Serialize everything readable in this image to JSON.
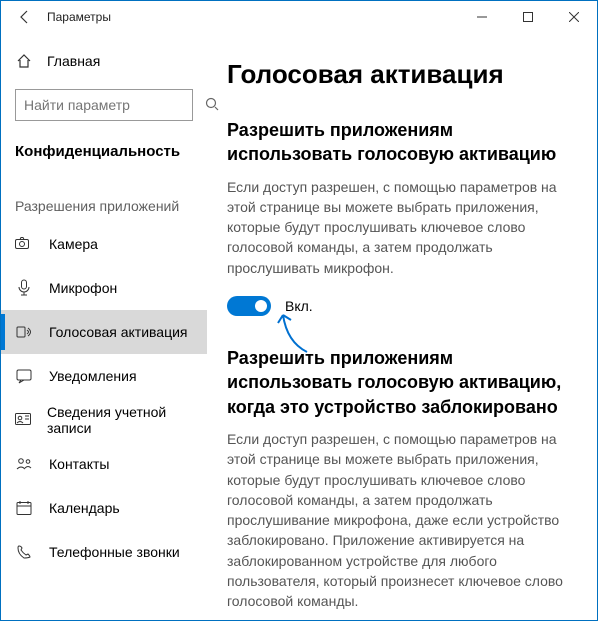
{
  "titlebar": {
    "title": "Параметры"
  },
  "sidebar": {
    "home": "Главная",
    "search_placeholder": "Найти параметр",
    "section": "Конфиденциальность",
    "subsection": "Разрешения приложений",
    "items": [
      {
        "label": "Камера"
      },
      {
        "label": "Микрофон"
      },
      {
        "label": "Голосовая активация"
      },
      {
        "label": "Уведомления"
      },
      {
        "label": "Сведения учетной записи"
      },
      {
        "label": "Контакты"
      },
      {
        "label": "Календарь"
      },
      {
        "label": "Телефонные звонки"
      }
    ]
  },
  "main": {
    "title": "Голосовая активация",
    "section1": {
      "heading": "Разрешить приложениям использовать голосовую активацию",
      "desc": "Если доступ разрешен, с помощью параметров на этой странице вы можете выбрать приложения, которые будут прослушивать ключевое слово голосовой команды, а затем продолжать прослушивать микрофон.",
      "toggle_label": "Вкл."
    },
    "section2": {
      "heading": "Разрешить приложениям использовать голосовую активацию, когда это устройство заблокировано",
      "desc": "Если доступ разрешен, с помощью параметров на этой странице вы можете выбрать приложения, которые будут прослушивать ключевое слово голосовой команды, а затем продолжать прослушивание микрофона, даже если устройство заблокировано. Приложение активируется на заблокированном устройстве для любого пользователя, который произнесет ключевое слово голосовой команды."
    }
  }
}
